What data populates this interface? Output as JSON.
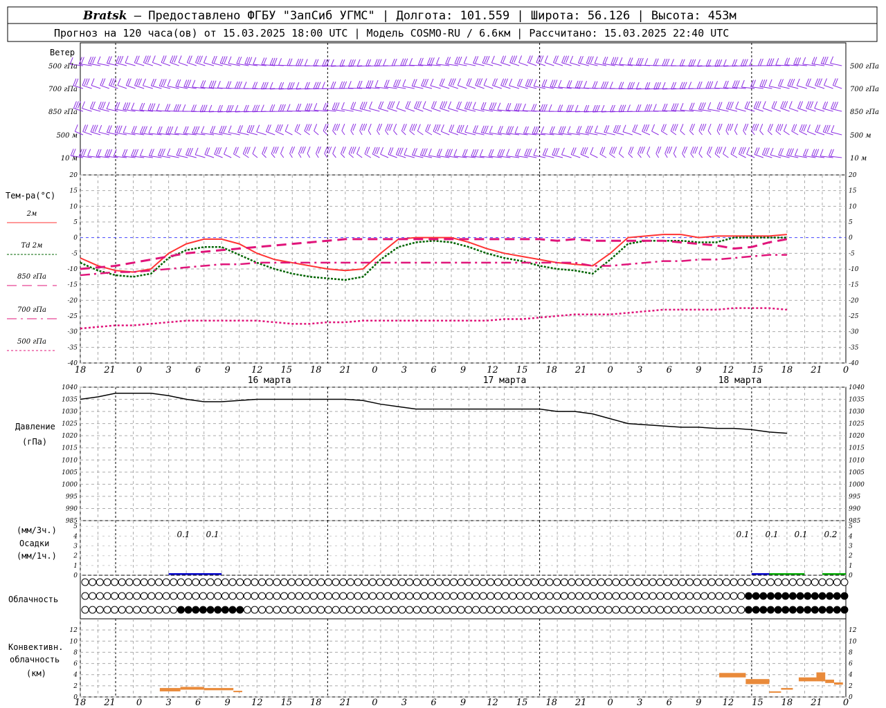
{
  "header": {
    "station": "Bratsk",
    "line1_rest": " — Предоставлено ФГБУ \"ЗапСиб УГМС\" | Долгота: 101.559 | Широта: 56.126 | Высота: 453м",
    "line2": "Прогноз на 120 часа(ов) от 15.03.2025 18:00 UTC  | Модель COSMO-RU / 6.6км | Рассчитано: 15.03.2025 22:40 UTC"
  },
  "time_axis": {
    "hour_labels": [
      "18",
      "21",
      "0",
      "3",
      "6",
      "9",
      "12",
      "15",
      "18",
      "21",
      "0",
      "3",
      "6",
      "9",
      "12",
      "15",
      "18",
      "21",
      "0",
      "3",
      "6",
      "9",
      "12",
      "15",
      "18",
      "21",
      "0"
    ],
    "day_labels": [
      "16 марта",
      "17 марта",
      "18 марта"
    ]
  },
  "wind_panel": {
    "title": "Ветер",
    "levels": [
      "500 гПа",
      "700 гПа",
      "850 гПа",
      "500 м",
      "10  м"
    ],
    "color": "#8a2be2"
  },
  "temp_panel": {
    "title": "Тем-ра(°C)",
    "legend": [
      {
        "label": "2м",
        "color": "#ff3333"
      },
      {
        "label": "Td  2м",
        "color": "#006400"
      },
      {
        "label": "850 гПа",
        "color": "#e0147a"
      },
      {
        "label": "700 гПа",
        "color": "#e0147a"
      },
      {
        "label": "500 гПа",
        "color": "#e0147a"
      }
    ],
    "ticks": [
      "20",
      "15",
      "10",
      "5",
      "0",
      "-5",
      "-10",
      "-15",
      "-20",
      "-25",
      "-30",
      "-35",
      "-40"
    ]
  },
  "pressure_panel": {
    "title": "Давление",
    "unit": "(гПа)",
    "ticks": [
      "1040",
      "1035",
      "1030",
      "1025",
      "1020",
      "1015",
      "1010",
      "1005",
      "1000",
      "995",
      "990",
      "985"
    ]
  },
  "precip_panel": {
    "unit_top": "(мм/3ч.)",
    "title": "Осадки",
    "unit_bottom": "(мм/1ч.)",
    "ticks": [
      "5",
      "4",
      "3",
      "2",
      "1",
      "0"
    ],
    "labels": [
      "0.1",
      "0.1",
      "0.1",
      "0.1",
      "0.1",
      "0.2"
    ]
  },
  "cloud_panel": {
    "title": "Облачность"
  },
  "conv_panel": {
    "title_1": "Конвективн.",
    "title_2": "облачность",
    "unit": "(км)",
    "ticks": [
      "12",
      "10",
      "8",
      "6",
      "4",
      "2",
      "0"
    ]
  },
  "chart_data": [
    {
      "type": "line",
      "title": "Тем-ра(°C)",
      "x_hours": [
        0,
        3,
        6,
        9,
        12,
        15,
        18,
        21,
        24,
        27,
        30,
        33,
        36,
        39,
        42,
        45,
        48,
        51,
        54,
        57,
        60,
        63,
        66,
        69,
        72,
        75,
        78,
        81,
        84,
        87,
        90,
        93,
        96,
        99,
        102,
        105,
        108,
        111,
        114,
        117,
        120
      ],
      "ylim": [
        -40,
        20
      ],
      "series": [
        {
          "name": "2м",
          "color": "#ff3333",
          "values": [
            -6.5,
            -9,
            -10.5,
            -11,
            -10,
            -5,
            -2,
            -0.5,
            -0.5,
            -2,
            -5,
            -7,
            -8,
            -9,
            -10,
            -10.5,
            -10,
            -5,
            -0.5,
            0,
            0,
            0,
            -1.5,
            -3.5,
            -5,
            -6,
            -7,
            -8,
            -8.5,
            -9,
            -5,
            0,
            0.5,
            1,
            1,
            0,
            0.5,
            0.5,
            0.5,
            0.5,
            1
          ]
        },
        {
          "name": "Td  2м",
          "color": "#006400",
          "values": [
            -8,
            -10.5,
            -12,
            -12.5,
            -11.5,
            -6.5,
            -4,
            -3,
            -3,
            -5.5,
            -8,
            -10,
            -11.5,
            -12.5,
            -13,
            -13.5,
            -12.5,
            -7,
            -3,
            -1.5,
            -1,
            -1.5,
            -3,
            -5,
            -6.5,
            -7.5,
            -9,
            -10,
            -10.5,
            -11.5,
            -7,
            -2,
            -1,
            -1,
            -1,
            -1.5,
            -1.5,
            0,
            0,
            0,
            0
          ]
        },
        {
          "name": "850 гПа",
          "color": "#e0147a",
          "values": [
            -10,
            -9.5,
            -9,
            -8,
            -7,
            -6,
            -5,
            -4.5,
            -4,
            -3.5,
            -3,
            -2.5,
            -2,
            -1.5,
            -1,
            -0.5,
            -0.5,
            -0.5,
            -0.5,
            -0.5,
            -0.5,
            -0.5,
            -0.5,
            -0.5,
            -0.5,
            -0.5,
            -0.5,
            -1,
            -0.5,
            -1,
            -1,
            -1,
            -1,
            -1,
            -1.5,
            -2,
            -2.5,
            -3.5,
            -3,
            -1.5,
            -0.5
          ]
        },
        {
          "name": "700 гПа",
          "color": "#e0147a",
          "values": [
            -12,
            -11.5,
            -11,
            -11,
            -10.5,
            -10,
            -9.5,
            -9,
            -8.5,
            -8.5,
            -8,
            -8,
            -8,
            -8,
            -8,
            -8,
            -8,
            -8,
            -8,
            -8,
            -8,
            -8,
            -8,
            -8,
            -8,
            -8,
            -8,
            -8,
            -8,
            -9,
            -9,
            -8.5,
            -8,
            -7.5,
            -7.5,
            -7,
            -7,
            -6.5,
            -6,
            -5.5,
            -5.5
          ]
        },
        {
          "name": "500 гПа",
          "color": "#e0147a",
          "values": [
            -29,
            -28.5,
            -28,
            -28,
            -27.5,
            -27,
            -26.5,
            -26.5,
            -26.5,
            -26.5,
            -26.5,
            -27,
            -27.5,
            -27.5,
            -27,
            -27,
            -26.5,
            -26.5,
            -26.5,
            -26.5,
            -26.5,
            -26.5,
            -26.5,
            -26.5,
            -26,
            -26,
            -25.5,
            -25,
            -24.5,
            -24.5,
            -24.5,
            -24,
            -23.5,
            -23,
            -23,
            -23,
            -23,
            -22.5,
            -22.5,
            -22.5,
            -23
          ]
        }
      ]
    },
    {
      "type": "line",
      "title": "Давление",
      "ylabel": "(гПа)",
      "x_hours": [
        0,
        3,
        6,
        9,
        12,
        15,
        18,
        21,
        24,
        27,
        30,
        33,
        36,
        39,
        42,
        45,
        48,
        51,
        54,
        57,
        60,
        63,
        66,
        69,
        72,
        75,
        78,
        81,
        84,
        87,
        90,
        93,
        96,
        99,
        102,
        105,
        108,
        111,
        114,
        117,
        120
      ],
      "ylim": [
        985,
        1040
      ],
      "series": [
        {
          "name": "Давление",
          "color": "#000000",
          "values": [
            1035,
            1036,
            1037.5,
            1037.5,
            1037.5,
            1036.5,
            1035,
            1034,
            1034,
            1034.5,
            1035,
            1035,
            1035,
            1035,
            1035,
            1035,
            1034.5,
            1033,
            1032,
            1031,
            1031,
            1031,
            1031,
            1031,
            1031,
            1031,
            1031,
            1030,
            1030,
            1029,
            1027,
            1025,
            1024.5,
            1024,
            1023.5,
            1023.5,
            1023,
            1023,
            1022.5,
            1021.5,
            1021
          ]
        }
      ]
    },
    {
      "type": "bar",
      "title": "Осадки",
      "ylabel": "(мм/3ч.)",
      "ylim": [
        0,
        5
      ],
      "bars": [
        {
          "from_h": 15,
          "to_h": 24,
          "value": 0.1,
          "color": "#0000cc"
        },
        {
          "from_h": 114,
          "to_h": 120,
          "value": 0.1,
          "color": "#0000cc"
        },
        {
          "from_h": 117,
          "to_h": 123,
          "value": 0.1,
          "color": "#00aa00"
        },
        {
          "from_h": 126,
          "to_h": 130,
          "value": 0.1,
          "color": "#00aa00"
        }
      ]
    },
    {
      "type": "bar",
      "title": "Конвективн. облачность",
      "ylabel": "(км)",
      "ylim": [
        0,
        14
      ],
      "bars": [
        {
          "from_h": 13.5,
          "to_h": 17,
          "bottom": 1.0,
          "top": 1.6
        },
        {
          "from_h": 17,
          "to_h": 21,
          "bottom": 1.3,
          "top": 1.8
        },
        {
          "from_h": 21,
          "to_h": 26,
          "bottom": 1.2,
          "top": 1.6
        },
        {
          "from_h": 26,
          "to_h": 27.5,
          "bottom": 0.9,
          "top": 1.1
        },
        {
          "from_h": 108.5,
          "to_h": 113,
          "bottom": 3.5,
          "top": 4.3
        },
        {
          "from_h": 113,
          "to_h": 117,
          "bottom": 2.3,
          "top": 3.2
        },
        {
          "from_h": 117,
          "to_h": 119,
          "bottom": 0.8,
          "top": 1.0
        },
        {
          "from_h": 119,
          "to_h": 121,
          "bottom": 1.3,
          "top": 1.6
        },
        {
          "from_h": 122,
          "to_h": 125,
          "bottom": 2.8,
          "top": 3.5
        },
        {
          "from_h": 125,
          "to_h": 126.5,
          "bottom": 2.8,
          "top": 4.4
        },
        {
          "from_h": 126.5,
          "to_h": 128,
          "bottom": 2.5,
          "top": 3.1
        },
        {
          "from_h": 128,
          "to_h": 129.5,
          "bottom": 2.2,
          "top": 2.6
        }
      ]
    }
  ]
}
